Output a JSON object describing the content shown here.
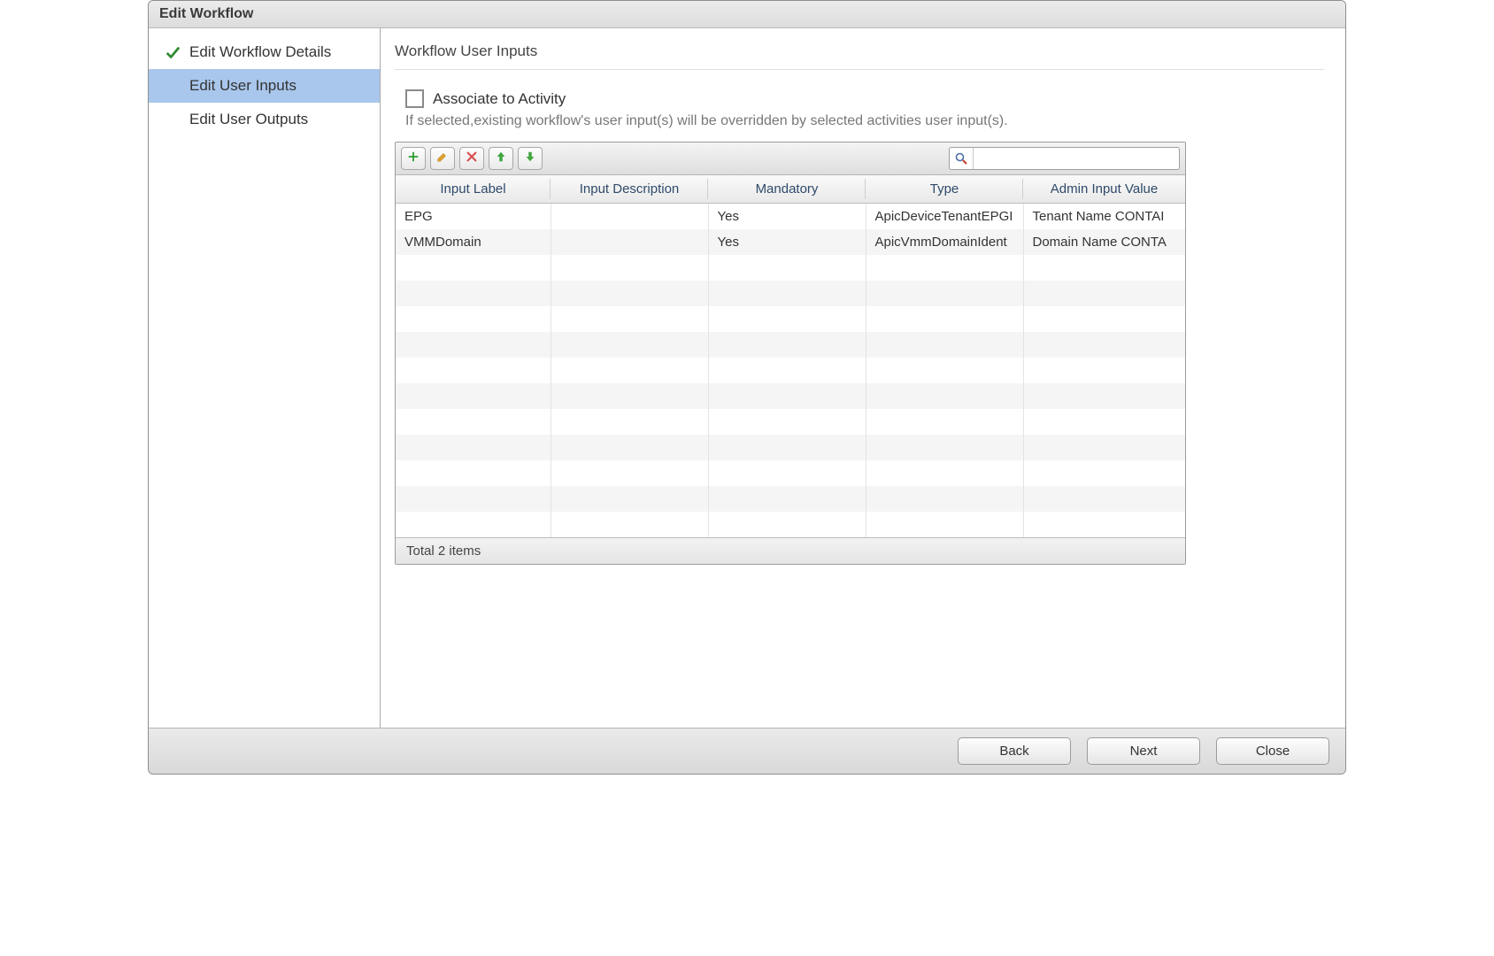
{
  "window": {
    "title": "Edit Workflow"
  },
  "sidebar": {
    "items": [
      {
        "label": "Edit Workflow Details",
        "state": "done"
      },
      {
        "label": "Edit User Inputs",
        "state": "active"
      },
      {
        "label": "Edit User Outputs",
        "state": "pending"
      }
    ]
  },
  "main": {
    "heading": "Workflow User Inputs",
    "associate": {
      "label": "Associate to Activity",
      "checked": false,
      "help": "If selected,existing workflow's user input(s) will be overridden by selected activities user input(s)."
    },
    "toolbar": {
      "add": "add",
      "edit": "edit",
      "delete": "delete",
      "up": "up",
      "down": "down",
      "search_placeholder": ""
    },
    "table": {
      "columns": [
        "Input Label",
        "Input Description",
        "Mandatory",
        "Type",
        "Admin Input Value"
      ],
      "rows": [
        {
          "label": "EPG",
          "description": "",
          "mandatory": "Yes",
          "type": "ApicDeviceTenantEPGI",
          "admin": "Tenant Name CONTAI"
        },
        {
          "label": "VMMDomain",
          "description": "",
          "mandatory": "Yes",
          "type": "ApicVmmDomainIdent",
          "admin": "Domain Name CONTA"
        }
      ],
      "empty_rows": 11,
      "footer": "Total 2 items"
    }
  },
  "footer": {
    "back": "Back",
    "next": "Next",
    "close": "Close"
  }
}
